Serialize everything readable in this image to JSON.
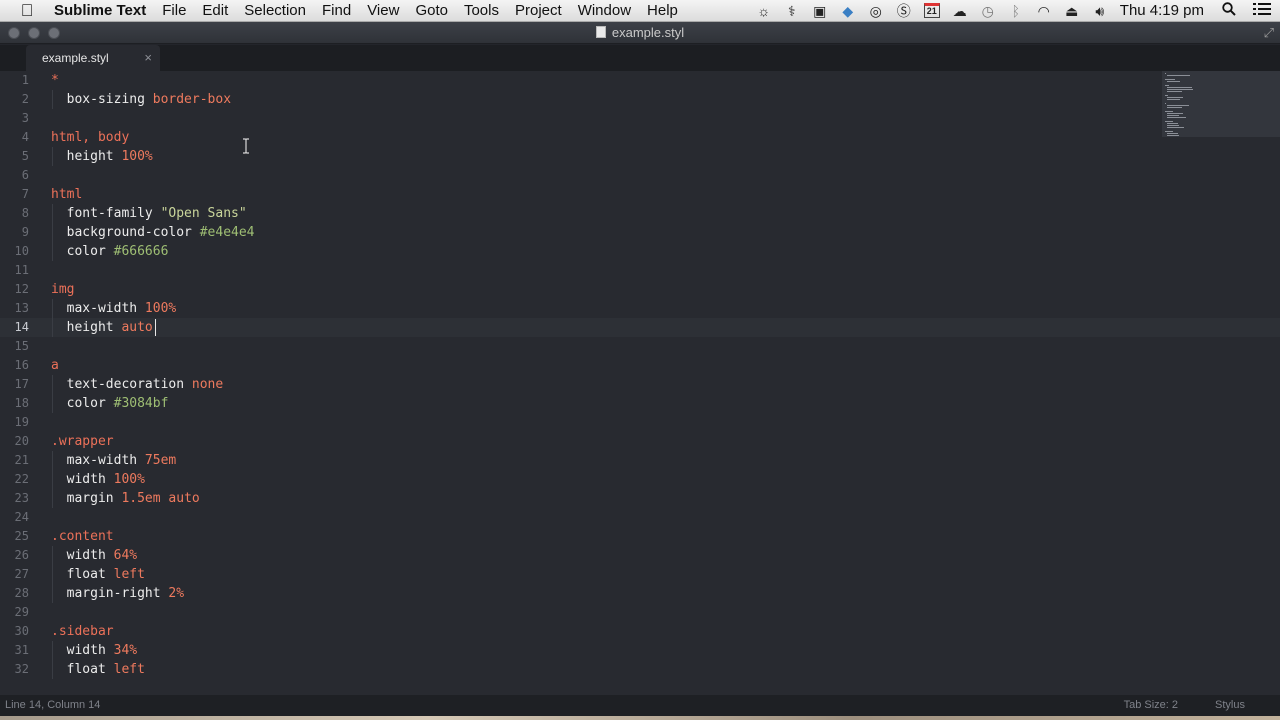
{
  "menubar": {
    "app_name": "Sublime Text",
    "items": [
      "File",
      "Edit",
      "Selection",
      "Find",
      "View",
      "Goto",
      "Tools",
      "Project",
      "Window",
      "Help"
    ],
    "calendar_day": "21",
    "clock": "Thu 4:19 pm",
    "tray_icons": [
      "brightness-icon",
      "rocket-icon",
      "camera-icon",
      "dropbox-icon",
      "creative-cloud-icon",
      "evernote-icon",
      "calendar-icon",
      "cloud-icon",
      "time-machine-icon",
      "bluetooth-icon",
      "wifi-icon",
      "eject-icon",
      "volume-icon"
    ]
  },
  "window": {
    "title": "example.styl"
  },
  "tab": {
    "label": "example.styl",
    "close": "×"
  },
  "editor": {
    "current_line": 14,
    "lines": [
      [
        {
          "t": "*",
          "c": "sel"
        }
      ],
      [
        {
          "t": "  box-sizing ",
          "c": "prop"
        },
        {
          "t": "border-box",
          "c": "val"
        }
      ],
      [],
      [
        {
          "t": "html, body",
          "c": "sel"
        }
      ],
      [
        {
          "t": "  height ",
          "c": "prop"
        },
        {
          "t": "100%",
          "c": "val"
        }
      ],
      [],
      [
        {
          "t": "html",
          "c": "sel"
        }
      ],
      [
        {
          "t": "  font-family ",
          "c": "prop"
        },
        {
          "t": "\"Open Sans\"",
          "c": "str"
        }
      ],
      [
        {
          "t": "  background-color ",
          "c": "prop"
        },
        {
          "t": "#e4e4e4",
          "c": "hex"
        }
      ],
      [
        {
          "t": "  color ",
          "c": "prop"
        },
        {
          "t": "#666666",
          "c": "hex"
        }
      ],
      [],
      [
        {
          "t": "img",
          "c": "sel"
        }
      ],
      [
        {
          "t": "  max-width ",
          "c": "prop"
        },
        {
          "t": "100%",
          "c": "val"
        }
      ],
      [
        {
          "t": "  height ",
          "c": "prop"
        },
        {
          "t": "auto",
          "c": "val"
        }
      ],
      [],
      [
        {
          "t": "a",
          "c": "sel"
        }
      ],
      [
        {
          "t": "  text-decoration ",
          "c": "prop"
        },
        {
          "t": "none",
          "c": "val"
        }
      ],
      [
        {
          "t": "  color ",
          "c": "prop"
        },
        {
          "t": "#3084bf",
          "c": "hex"
        }
      ],
      [],
      [
        {
          "t": ".wrapper",
          "c": "sel"
        }
      ],
      [
        {
          "t": "  max-width ",
          "c": "prop"
        },
        {
          "t": "75em",
          "c": "val"
        }
      ],
      [
        {
          "t": "  width ",
          "c": "prop"
        },
        {
          "t": "100%",
          "c": "val"
        }
      ],
      [
        {
          "t": "  margin ",
          "c": "prop"
        },
        {
          "t": "1.5em auto",
          "c": "val"
        }
      ],
      [],
      [
        {
          "t": ".content",
          "c": "sel"
        }
      ],
      [
        {
          "t": "  width ",
          "c": "prop"
        },
        {
          "t": "64%",
          "c": "val"
        }
      ],
      [
        {
          "t": "  float ",
          "c": "prop"
        },
        {
          "t": "left",
          "c": "val"
        }
      ],
      [
        {
          "t": "  margin-right ",
          "c": "prop"
        },
        {
          "t": "2%",
          "c": "val"
        }
      ],
      [],
      [
        {
          "t": ".sidebar",
          "c": "sel"
        }
      ],
      [
        {
          "t": "  width ",
          "c": "prop"
        },
        {
          "t": "34%",
          "c": "val"
        }
      ],
      [
        {
          "t": "  float ",
          "c": "prop"
        },
        {
          "t": "left",
          "c": "val"
        }
      ]
    ]
  },
  "statusbar": {
    "position": "Line 14, Column 14",
    "tab_size": "Tab Size: 2",
    "syntax": "Stylus"
  },
  "colors": {
    "editor_bg": "#282a30",
    "selector": "#ec7159",
    "value": "#ee7a5e",
    "string": "#c9d59b",
    "hex": "#9fbf74"
  }
}
